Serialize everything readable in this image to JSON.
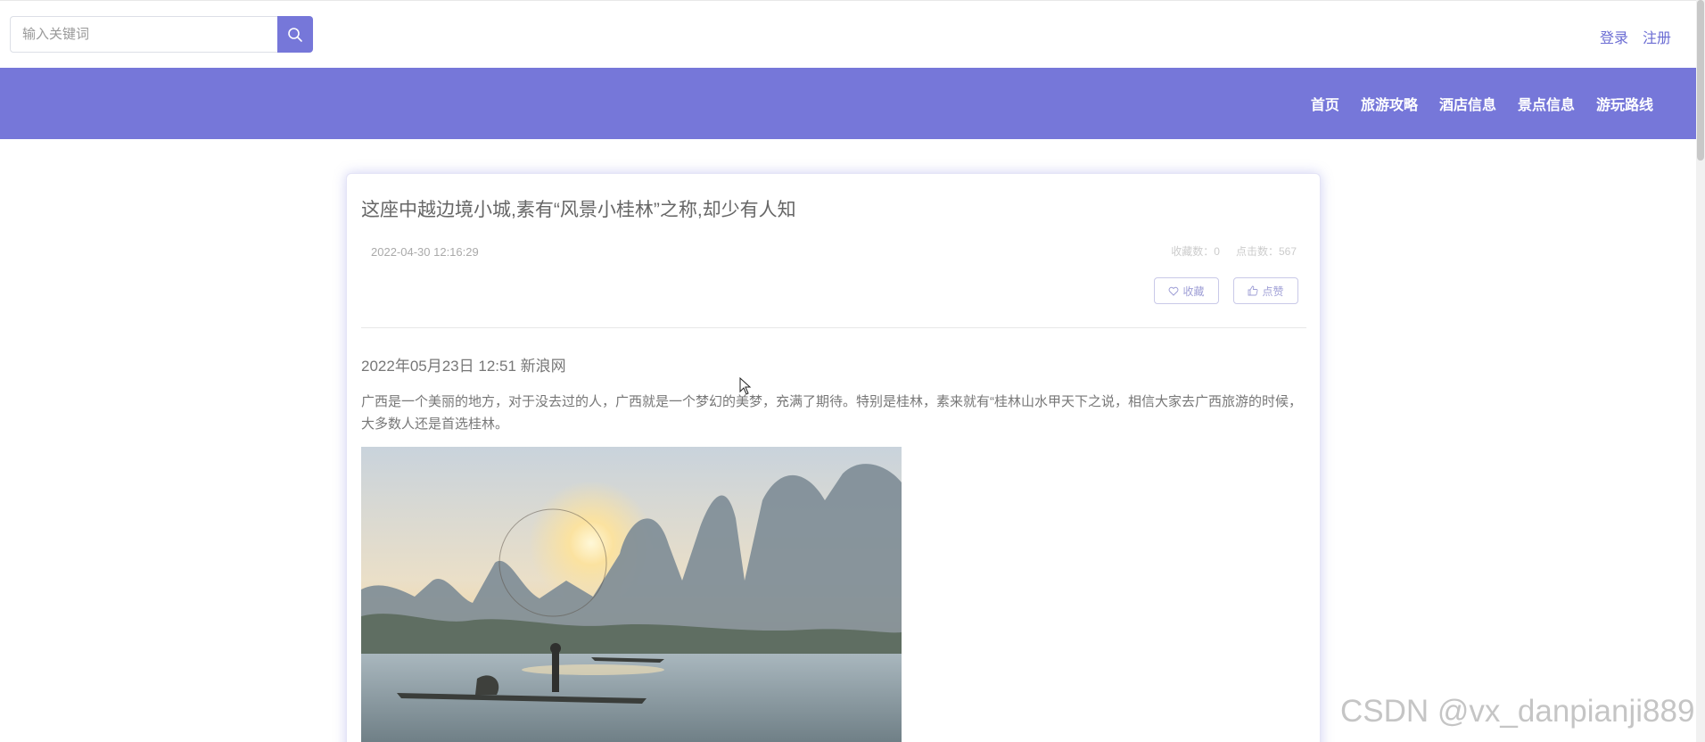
{
  "header": {
    "search_placeholder": "输入关键词",
    "login": "登录",
    "register": "注册"
  },
  "nav": {
    "items": [
      "首页",
      "旅游攻略",
      "酒店信息",
      "景点信息",
      "游玩路线"
    ]
  },
  "article": {
    "title": "这座中越边境小城,素有“风景小桂林”之称,却少有人知",
    "date": "2022-04-30 12:16:29",
    "favorites": "收藏数：0",
    "clicks": "点击数：567",
    "favorite_button": "收藏",
    "like_button": "点赞",
    "source": "2022年05月23日 12:51 新浪网",
    "paragraph": "广西是一个美丽的地方，对于没去过的人，广西就是一个梦幻的美梦，充满了期待。特别是桂林，素来就有“桂林山水甲天下之说，相信大家去广西旅游的时候，大多数人还是首选桂林。"
  },
  "watermark": "CSDN @vx_danpianji889",
  "colors": {
    "accent": "#7677d9",
    "link": "#6b6cd3"
  }
}
